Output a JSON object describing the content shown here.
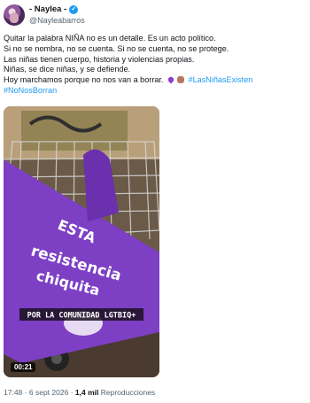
{
  "author": {
    "name": "- Naylea -",
    "handle": "@Nayleabarros"
  },
  "tweet": {
    "lines": [
      "Quitar la palabra NIÑA no es un detalle. Es un acto político.",
      "Si no se nombra, no se cuenta. Si no se cuenta, no se protege.",
      "Las niñas tienen cuerpo, historia y violencias propias.",
      "Niñas, se dice niñas, y se defiende.",
      "Hoy marchamos porque no nos van a borrar."
    ],
    "hashtag_1": "#LasNiñasExisten",
    "hashtag_2": "#NoNosBorran",
    "emojis": [
      "purple-heart",
      "raised-fist"
    ]
  },
  "media": {
    "banner_text_1": "ESTA",
    "banner_text_2": "resistencia",
    "banner_text_3": "chiquita",
    "caption": "POR LA COMUNIDAD LGTBIQ+",
    "duration": "00:21"
  },
  "footer": {
    "time": "17:48",
    "separator": "·",
    "date": "6 sept 2026",
    "views_count": "1,4 mil",
    "views_label": "Reproducciones"
  },
  "colors": {
    "accent_blue": "#1d9bf0",
    "banner_purple": "#7d3fc4",
    "text_primary": "#0f1419",
    "text_secondary": "#536471"
  }
}
